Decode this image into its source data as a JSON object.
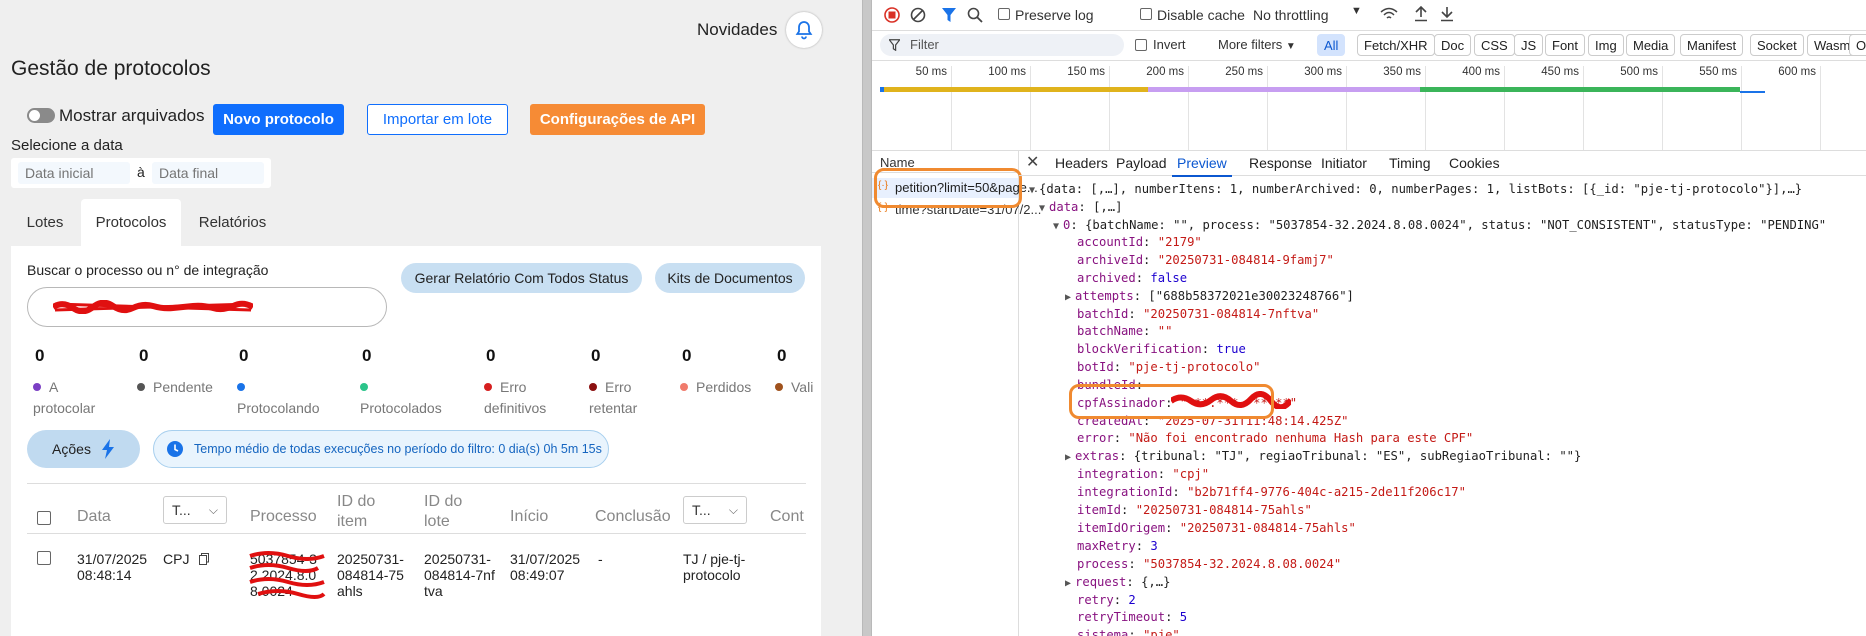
{
  "app": {
    "novidades": "Novidades",
    "page_title": "Gestão de protocolos",
    "toggle_label": "Mostrar arquivados",
    "btn_new": "Novo protocolo",
    "btn_import": "Importar em lote",
    "btn_api": "Configurações de API",
    "date_label": "Selecione a data",
    "date_start_placeholder": "Data inicial",
    "date_sep": "à",
    "date_end_placeholder": "Data final",
    "tabs": [
      "Lotes",
      "Protocolos",
      "Relatórios"
    ],
    "search_label": "Buscar o processo ou n° de integração",
    "btn_report": "Gerar Relatório Com Todos Status",
    "btn_kits": "Kits de Documentos",
    "stats": [
      {
        "count": "0",
        "label": "A protocolar",
        "color": "#7b3fc4"
      },
      {
        "count": "0",
        "label": "Pendente",
        "color": "#555555"
      },
      {
        "count": "0",
        "label": "Protocolando",
        "color": "#1a73e8"
      },
      {
        "count": "0",
        "label": "Protocolados",
        "color": "#2bc48a"
      },
      {
        "count": "0",
        "label": "Erro definitivos",
        "color": "#d61f1f"
      },
      {
        "count": "0",
        "label": "Erro retentar",
        "color": "#8b1010"
      },
      {
        "count": "0",
        "label": "Perdidos",
        "color": "#f07b6c"
      },
      {
        "count": "0",
        "label": "Vali",
        "color": "#a0521d"
      }
    ],
    "acoes": "Ações",
    "info": "Tempo médio de todas execuções no período do filtro: 0 dia(s) 0h 5m 15s",
    "columns": [
      "Data",
      "T...",
      "Processo",
      "ID do item",
      "ID do lote",
      "Início",
      "Conclusão",
      "T...",
      "Cont"
    ],
    "row": {
      "data": "31/07/2025 08:48:14",
      "tipo": "CPJ",
      "processo": "5037854-32.2024.8.08.0024",
      "id_item": "20250731-084814-75ahls",
      "id_lote": "20250731-084814-7nftva",
      "inicio": "31/07/2025 08:49:07",
      "conclusao": "-",
      "tribunal": "TJ / pje-tj-protocolo"
    }
  },
  "devtools": {
    "toolbar": {
      "preserve_log": "Preserve log",
      "disable_cache": "Disable cache",
      "throttling": "No throttling"
    },
    "filter_placeholder": "Filter",
    "invert": "Invert",
    "more_filters": "More filters",
    "chips": [
      "All",
      "Fetch/XHR",
      "Doc",
      "CSS",
      "JS",
      "Font",
      "Img",
      "Media",
      "Manifest",
      "Socket",
      "Wasm",
      "Ot"
    ],
    "ticks": [
      "50 ms",
      "100 ms",
      "150 ms",
      "200 ms",
      "250 ms",
      "300 ms",
      "350 ms",
      "400 ms",
      "450 ms",
      "500 ms",
      "550 ms",
      "600 ms"
    ],
    "name_header": "Name",
    "requests": [
      "petition?limit=50&page...",
      "time?startDate=31/07/2..."
    ],
    "panel_tabs": [
      "Headers",
      "Payload",
      "Preview",
      "Response",
      "Initiator",
      "Timing",
      "Cookies"
    ],
    "preview": {
      "root": "{data: [,…], numberItens: 1, numberArchived: 0, numberPages: 1, listBots: [{_id: \"pje-tj-protocolo\"}],…}",
      "data_line": "[,…]",
      "item0": "{batchName: \"\", process: \"5037854-32.2024.8.08.0024\", status: \"NOT_CONSISTENT\", statusType: \"PENDING\"",
      "accountId": "\"2179\"",
      "archiveId": "\"20250731-084814-9famj7\"",
      "archived": "false",
      "attempts": "[\"688b58372021e30023248766\"]",
      "batchId": "\"20250731-084814-7nftva\"",
      "batchName": "\"\"",
      "blockVerification": "true",
      "botId": "\"pje-tj-protocolo\"",
      "bundleId": "",
      "cpfAssinador": "\"***.***.***-**\"",
      "createdAt": "\"2025-07-31T11:48:14.425Z\"",
      "error": "\"Não foi encontrado nenhuma Hash para este CPF\"",
      "extras": "{tribunal: \"TJ\", regiaoTribunal: \"ES\", subRegiaoTribunal: \"\"}",
      "integration": "\"cpj\"",
      "integrationId": "\"b2b71ff4-9776-404c-a215-2de11f206c17\"",
      "itemId": "\"20250731-084814-75ahls\"",
      "itemIdOrigem": "\"20250731-084814-75ahls\"",
      "maxRetry": "3",
      "process": "\"5037854-32.2024.8.08.0024\"",
      "request": "{,…}",
      "retry": "2",
      "retryTimeout": "5",
      "sistema": "\"pje\""
    }
  }
}
